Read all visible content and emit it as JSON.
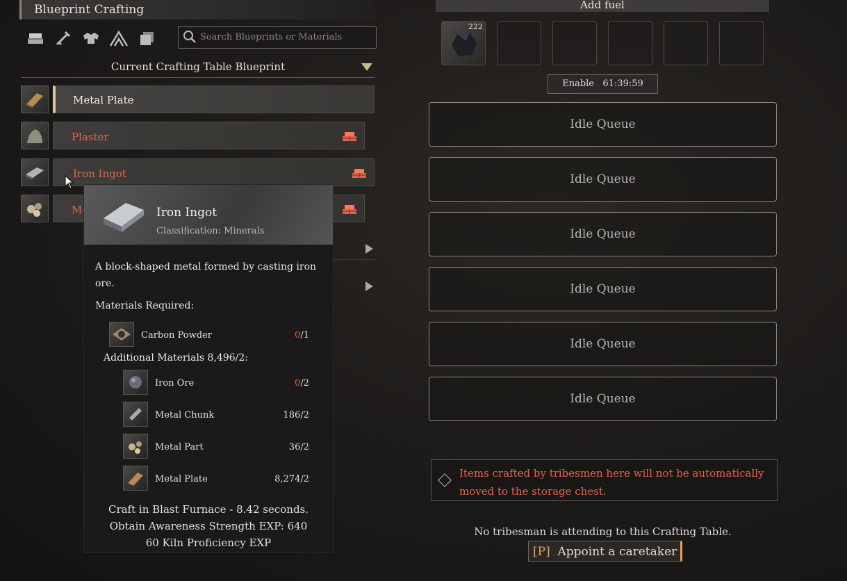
{
  "header": {
    "title": "Blueprint Crafting"
  },
  "categories": [
    "materials-icon",
    "weapon-icon",
    "armor-icon",
    "structure-icon",
    "other-icon"
  ],
  "search": {
    "placeholder": "Search Blueprints or Materials"
  },
  "section": {
    "title": "Current Crafting Table Blueprint"
  },
  "blueprints": [
    {
      "label": "Metal Plate",
      "selected": true,
      "available": true
    },
    {
      "label": "Plaster",
      "available": false
    },
    {
      "label": "Iron Ingot",
      "available": false,
      "hovered": true
    },
    {
      "label": "Me",
      "available": false
    }
  ],
  "tooltip": {
    "name": "Iron Ingot",
    "classification": "Classification: Minerals",
    "description": "A block-shaped metal formed by casting iron ore.",
    "materials_title": "Materials Required:",
    "materials": [
      {
        "name": "Carbon Powder",
        "have": "0",
        "need": "/1",
        "insufficient": true
      }
    ],
    "additional_title": "Additional Materials 8,496/2:",
    "additional": [
      {
        "name": "Iron Ore",
        "have": "0",
        "need": "/2",
        "insufficient": true
      },
      {
        "name": "Metal Chunk",
        "have": "186",
        "need": "/2",
        "insufficient": false
      },
      {
        "name": "Metal Part",
        "have": "36",
        "need": "/2",
        "insufficient": false
      },
      {
        "name": "Metal Plate",
        "have": "8,274",
        "need": "/2",
        "insufficient": false
      }
    ],
    "footer": [
      "Craft in Blast Furnace - 8.42 seconds.",
      "Obtain Awareness Strength EXP: 640",
      "60 Kiln Proficiency EXP"
    ]
  },
  "fuel": {
    "header": "Add fuel",
    "slots": [
      {
        "count": "222",
        "item": "coal"
      },
      {},
      {},
      {},
      {},
      {}
    ]
  },
  "enable": {
    "label": "Enable",
    "timer": "61:39:59"
  },
  "queues": [
    "Idle Queue",
    "Idle Queue",
    "Idle Queue",
    "Idle Queue",
    "Idle Queue",
    "Idle Queue"
  ],
  "warning": "Items crafted by tribesmen here will not be automatically moved to the storage chest.",
  "caretaker": {
    "note": "No tribesman is attending to this Crafting Table.",
    "key": "[P]",
    "label": "Appoint a caretaker"
  },
  "colors": {
    "warning": "#e8604c",
    "accent": "#e8a050",
    "selected_marker": "#d8c898"
  }
}
